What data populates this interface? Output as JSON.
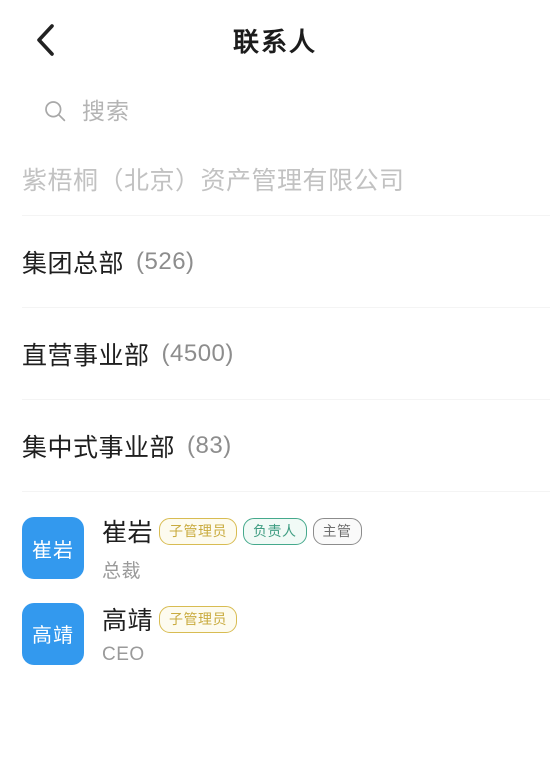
{
  "header": {
    "title": "联系人",
    "back_icon": "chevron-left-icon"
  },
  "search": {
    "icon": "search-icon",
    "placeholder": "搜索",
    "value": ""
  },
  "organization": {
    "name": "紫梧桐（北京）资产管理有限公司"
  },
  "departments": [
    {
      "name": "集团总部",
      "count": "(526)"
    },
    {
      "name": "直营事业部",
      "count": "(4500)"
    },
    {
      "name": "集中式事业部",
      "count": "(83)"
    }
  ],
  "contacts": [
    {
      "avatar_text": "崔岩",
      "avatar_color": "#3399ee",
      "name": "崔岩",
      "title": "总裁",
      "tags": [
        {
          "label": "子管理员",
          "style": "gold"
        },
        {
          "label": "负责人",
          "style": "green"
        },
        {
          "label": "主管",
          "style": "gray"
        }
      ]
    },
    {
      "avatar_text": "高靖",
      "avatar_color": "#3399ee",
      "name": "高靖",
      "title": "CEO",
      "tags": [
        {
          "label": "子管理员",
          "style": "gold"
        }
      ]
    }
  ],
  "colors": {
    "accent": "#3399ee",
    "tag_gold": "#d8bc52",
    "tag_green": "#45a98c",
    "tag_gray": "#8c8c8c",
    "muted_text": "#9a9a9a",
    "org_text": "#c2c2c2"
  }
}
